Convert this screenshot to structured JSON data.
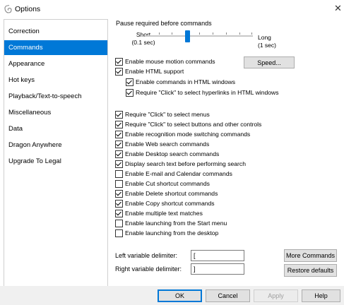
{
  "window": {
    "title": "Options",
    "app_icon": "dragon-icon",
    "close_icon": "close-icon"
  },
  "sidebar": {
    "items": [
      {
        "label": "Correction",
        "selected": false
      },
      {
        "label": "Commands",
        "selected": true
      },
      {
        "label": "Appearance",
        "selected": false
      },
      {
        "label": "Hot keys",
        "selected": false
      },
      {
        "label": "Playback/Text-to-speech",
        "selected": false
      },
      {
        "label": "Miscellaneous",
        "selected": false
      },
      {
        "label": "Data",
        "selected": false
      },
      {
        "label": "Dragon Anywhere",
        "selected": false
      },
      {
        "label": "Upgrade To Legal",
        "selected": false
      }
    ]
  },
  "pause": {
    "label": "Pause required before commands",
    "short_label": "Short",
    "short_value": "(0.1 sec)",
    "long_label": "Long",
    "long_value": "(1 sec)",
    "level": 0.38
  },
  "speed_button": "Speed...",
  "options": {
    "mouse_motion": {
      "label": "Enable mouse motion commands",
      "checked": true
    },
    "html_support": {
      "label": "Enable HTML support",
      "checked": true
    },
    "html_commands": {
      "label": "Enable commands in HTML windows",
      "checked": true
    },
    "html_click": {
      "label": "Require \"Click\" to select hyperlinks in HTML windows",
      "checked": true
    },
    "click_menus": {
      "label": "Require \"Click\" to select menus",
      "checked": true
    },
    "click_buttons": {
      "label": "Require \"Click\" to select buttons and other controls",
      "checked": true
    },
    "mode_switching": {
      "label": "Enable recognition mode switching commands",
      "checked": true
    },
    "web_search": {
      "label": "Enable Web search commands",
      "checked": true
    },
    "desktop_search": {
      "label": "Enable Desktop search commands",
      "checked": true
    },
    "display_search": {
      "label": "Display search text before performing search",
      "checked": true
    },
    "email_calendar": {
      "label": "Enable E-mail and Calendar commands",
      "checked": false
    },
    "cut_shortcut": {
      "label": "Enable Cut shortcut commands",
      "checked": false
    },
    "delete_shortcut": {
      "label": "Enable Delete shortcut commands",
      "checked": true
    },
    "copy_shortcut": {
      "label": "Enable Copy shortcut commands",
      "checked": true
    },
    "multiple_matches": {
      "label": "Enable multiple text matches",
      "checked": true
    },
    "launch_start": {
      "label": "Enable launching from the Start menu",
      "checked": false
    },
    "launch_desktop": {
      "label": "Enable launching from the desktop",
      "checked": false
    }
  },
  "delimiters": {
    "left_label": "Left variable delimiter:",
    "left_value": "[",
    "right_label": "Right variable delimiter:",
    "right_value": "]"
  },
  "more_commands_button": "More Commands",
  "restore_defaults_button": "Restore defaults",
  "footer": {
    "ok": "OK",
    "cancel": "Cancel",
    "apply": "Apply",
    "apply_enabled": false,
    "help": "Help"
  },
  "colors": {
    "accent": "#0078d7",
    "footer_bg": "#f0f0f0",
    "button_bg": "#e1e1e1"
  }
}
